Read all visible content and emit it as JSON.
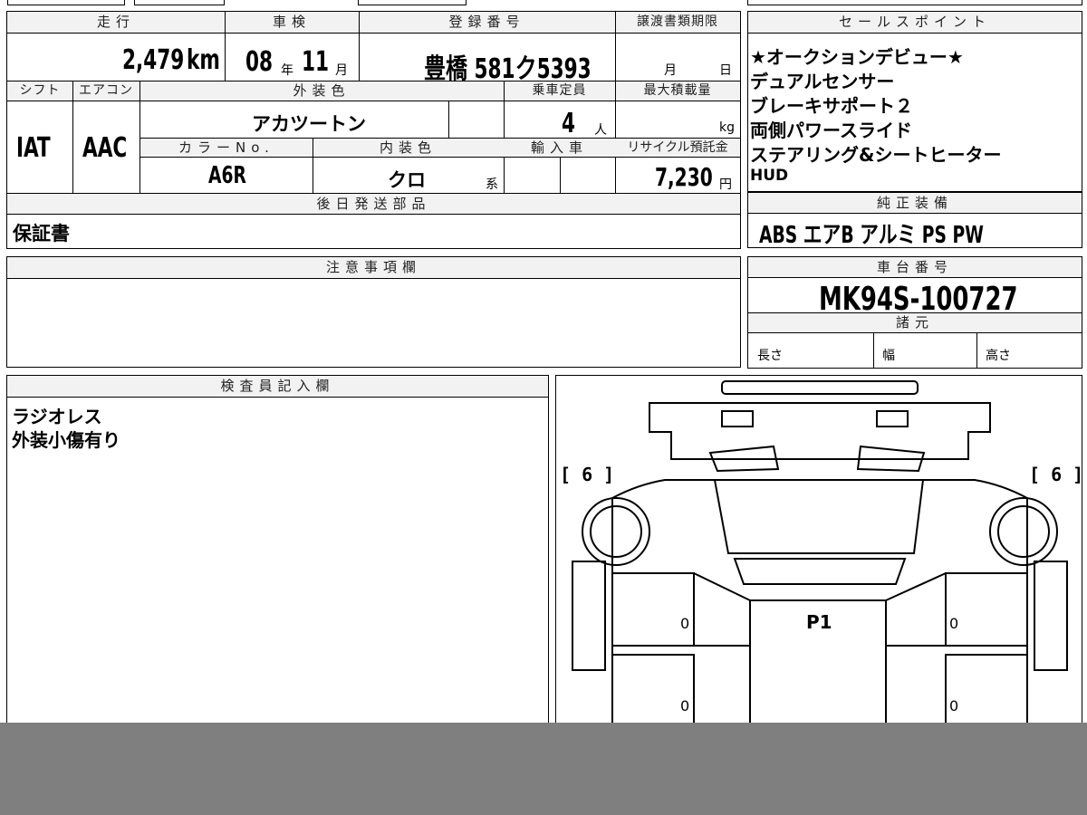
{
  "header": {
    "mileage": "走行",
    "inspection": "車検",
    "registration": "登録番号",
    "transfer_deadline": "譲渡書類期限",
    "sales_points": "セールスポイント"
  },
  "values": {
    "mileage": "2,479",
    "mileage_unit": "km",
    "inspection_year": "08",
    "year_unit": "年",
    "inspection_month": "11",
    "month_unit": "月",
    "plate": "豊橋 581ク5393",
    "deadline_month_unit": "月",
    "deadline_day_unit": "日"
  },
  "row2": {
    "shift_label": "シフト",
    "aircon_label": "エアコン",
    "exterior_color_label": "外装色",
    "capacity_label": "乗車定員",
    "max_load_label": "最大積載量",
    "shift": "IAT",
    "aircon": "AAC",
    "exterior_color": "アカツートン",
    "capacity": "4",
    "capacity_unit": "人",
    "max_load_unit": "kg",
    "color_no_label": "カラーNo.",
    "interior_label": "内装色",
    "import_label": "輸入車",
    "recycle_label": "リサイクル預託金",
    "color_no": "A6R",
    "interior": "クロ",
    "interior_unit": "系",
    "recycle": "7,230",
    "recycle_unit": "円"
  },
  "sales_points": [
    "★オークションデビュー★",
    "デュアルセンサー",
    "ブレーキサポート２",
    "両側パワースライド",
    "ステアリング&シートヒーター",
    "HUD"
  ],
  "later_parts": {
    "label": "後日発送部品",
    "value": "保証書"
  },
  "standard_equipment": {
    "label": "純正装備",
    "value": "ABS エアB アルミ PS PW"
  },
  "notes": {
    "label": "注意事項欄"
  },
  "chassis": {
    "label": "車台番号",
    "value": "MK94S-100727"
  },
  "specs": {
    "label": "諸元",
    "length": "長さ",
    "width": "幅",
    "height": "高さ"
  },
  "inspector": {
    "label": "検査員記入欄",
    "lines": [
      "ラジオレス",
      "外装小傷有り"
    ]
  },
  "diagram": {
    "tire_left": "[ 6 ]",
    "tire_right": "[ 6 ]",
    "center_mark": "P1",
    "zero_left_top": "0",
    "zero_left_bottom": "0",
    "zero_right_top": "0",
    "zero_right_bottom": "0"
  }
}
